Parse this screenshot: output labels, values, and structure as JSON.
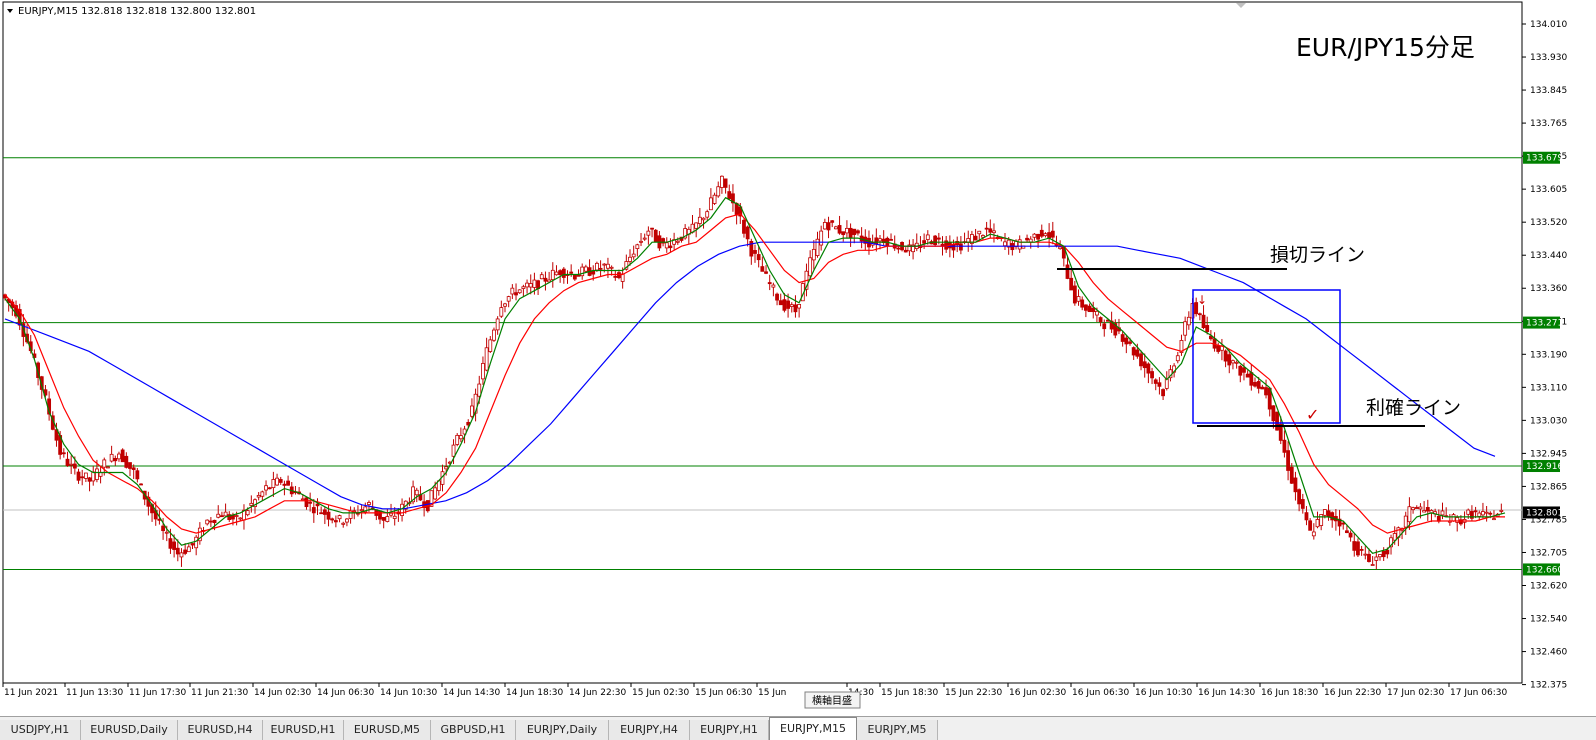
{
  "header": {
    "symbol_info": "EURJPY,M15  132.818 132.818 132.800 132.801"
  },
  "annotations": {
    "title": "EUR/JPY15分足",
    "stop_loss_label": "損切ライン",
    "take_profit_label": "利確ライン",
    "scroll_tooltip": "横軸目盛"
  },
  "colors": {
    "candle": "#c00000",
    "grid_hline": "#008000",
    "ma_fast": "#008000",
    "ma_mid": "#ff0000",
    "ma_slow": "#0000ff",
    "box": "#0000ff",
    "price_tag_bg": "#008000",
    "current_price_tag_bg": "#000000"
  },
  "chart_data": {
    "type": "candlestick",
    "symbol": "EURJPY",
    "timeframe": "M15",
    "ylim": [
      132.375,
      134.05
    ],
    "price_ticks": [
      "134.010",
      "133.930",
      "133.845",
      "133.765",
      "133.685",
      "133.605",
      "133.520",
      "133.440",
      "133.360",
      "133.271",
      "133.190",
      "133.110",
      "133.030",
      "132.945",
      "132.865",
      "132.785",
      "132.705",
      "132.620",
      "132.540",
      "132.460",
      "132.375"
    ],
    "horizontal_lines": [
      133.679,
      133.271,
      132.916,
      132.66
    ],
    "highlight_tags": [
      "133.679",
      "133.271",
      "132.916",
      "132.660"
    ],
    "current_price": "132.801",
    "time_labels": [
      "11 Jun 2021",
      "11 Jun 13:30",
      "11 Jun 17:30",
      "11 Jun 21:30",
      "14 Jun 02:30",
      "14 Jun 06:30",
      "14 Jun 10:30",
      "14 Jun 14:30",
      "14 Jun 18:30",
      "14 Jun 22:30",
      "15 Jun 02:30",
      "15 Jun 06:30",
      "15 Jun",
      "14:30",
      "15 Jun 18:30",
      "15 Jun 22:30",
      "16 Jun 02:30",
      "16 Jun 06:30",
      "16 Jun 10:30",
      "16 Jun 14:30",
      "16 Jun 18:30",
      "16 Jun 22:30",
      "17 Jun 02:30",
      "17 Jun 06:30"
    ],
    "close_path": [
      133.34,
      133.3,
      133.2,
      133.08,
      132.95,
      132.9,
      132.88,
      132.92,
      132.95,
      132.9,
      132.82,
      132.75,
      132.7,
      132.72,
      132.78,
      132.8,
      132.78,
      132.82,
      132.86,
      132.88,
      132.85,
      132.82,
      132.8,
      132.78,
      132.8,
      132.82,
      132.78,
      132.8,
      132.85,
      132.82,
      132.9,
      132.98,
      133.05,
      133.2,
      133.32,
      133.35,
      133.36,
      133.38,
      133.4,
      133.39,
      133.4,
      133.41,
      133.38,
      133.45,
      133.5,
      133.46,
      133.48,
      133.5,
      133.55,
      133.62,
      133.55,
      133.45,
      133.38,
      133.32,
      133.3,
      133.42,
      133.52,
      133.5,
      133.49,
      133.47,
      133.48,
      133.46,
      133.45,
      133.48,
      133.47,
      133.46,
      133.48,
      133.5,
      133.47,
      133.46,
      133.48,
      133.5,
      133.45,
      133.33,
      133.3,
      133.27,
      133.25,
      133.2,
      133.15,
      133.1,
      133.2,
      133.32,
      133.24,
      133.2,
      133.16,
      133.13,
      133.1,
      132.98,
      132.85,
      132.75,
      132.8,
      132.78,
      132.72,
      132.68,
      132.7,
      132.75,
      132.82,
      132.8,
      132.79,
      132.78,
      132.8,
      132.79,
      132.8
    ],
    "ma_fast": {
      "name": "",
      "values": [
        133.33,
        133.28,
        133.18,
        133.05,
        132.97,
        132.92,
        132.9,
        132.9,
        132.9,
        132.87,
        132.82,
        132.76,
        132.72,
        132.73,
        132.76,
        132.79,
        132.8,
        132.82,
        132.84,
        132.86,
        132.85,
        132.83,
        132.81,
        132.8,
        132.8,
        132.81,
        132.8,
        132.81,
        132.84,
        132.86,
        132.9,
        132.97,
        133.05,
        133.17,
        133.28,
        133.33,
        133.35,
        133.37,
        133.39,
        133.39,
        133.4,
        133.4,
        133.4,
        133.43,
        133.47,
        133.47,
        133.48,
        133.5,
        133.53,
        133.58,
        133.56,
        133.48,
        133.4,
        133.34,
        133.32,
        133.4,
        133.47,
        133.48,
        133.48,
        133.47,
        133.47,
        133.46,
        133.46,
        133.47,
        133.47,
        133.47,
        133.47,
        133.49,
        133.48,
        133.47,
        133.47,
        133.48,
        133.46,
        133.36,
        133.31,
        133.28,
        133.25,
        133.21,
        133.17,
        133.13,
        133.17,
        133.26,
        133.24,
        133.21,
        133.17,
        133.14,
        133.11,
        133.01,
        132.9,
        132.79,
        132.79,
        132.78,
        132.74,
        132.7,
        132.71,
        132.75,
        132.79,
        132.8,
        132.79,
        132.79,
        132.79,
        132.79,
        132.8
      ]
    },
    "ma_mid": {
      "name": "",
      "values": [
        133.34,
        133.3,
        133.24,
        133.15,
        133.06,
        132.99,
        132.93,
        132.9,
        132.88,
        132.86,
        132.83,
        132.79,
        132.76,
        132.75,
        132.76,
        132.77,
        132.78,
        132.79,
        132.81,
        132.83,
        132.83,
        132.83,
        132.82,
        132.81,
        132.8,
        132.8,
        132.8,
        132.8,
        132.81,
        132.82,
        132.85,
        132.9,
        132.96,
        133.05,
        133.14,
        133.22,
        133.28,
        133.32,
        133.35,
        133.37,
        133.38,
        133.39,
        133.39,
        133.41,
        133.43,
        133.44,
        133.46,
        133.47,
        133.5,
        133.53,
        133.54,
        133.5,
        133.45,
        133.4,
        133.37,
        133.38,
        133.42,
        133.44,
        133.45,
        133.45,
        133.46,
        133.46,
        133.46,
        133.46,
        133.46,
        133.47,
        133.47,
        133.48,
        133.48,
        133.47,
        133.47,
        133.47,
        133.46,
        133.42,
        133.37,
        133.33,
        133.3,
        133.27,
        133.24,
        133.21,
        133.2,
        133.22,
        133.22,
        133.21,
        133.19,
        133.16,
        133.13,
        133.07,
        133.0,
        132.92,
        132.87,
        132.84,
        132.81,
        132.77,
        132.75,
        132.76,
        132.77,
        132.78,
        132.78,
        132.78,
        132.78,
        132.79,
        132.79
      ]
    },
    "ma_slow": {
      "name": "",
      "values": [
        133.28,
        133.26,
        133.24,
        133.22,
        133.2,
        133.17,
        133.14,
        133.11,
        133.08,
        133.05,
        133.02,
        132.99,
        132.96,
        132.93,
        132.9,
        132.87,
        132.84,
        132.82,
        132.81,
        132.81,
        132.82,
        132.83,
        132.85,
        132.88,
        132.92,
        132.97,
        133.02,
        133.08,
        133.14,
        133.2,
        133.26,
        133.32,
        133.37,
        133.41,
        133.44,
        133.46,
        133.47,
        133.47,
        133.47,
        133.47,
        133.47,
        133.47,
        133.46,
        133.46,
        133.46,
        133.46,
        133.46,
        133.46,
        133.46,
        133.46,
        133.46,
        133.46,
        133.46,
        133.46,
        133.45,
        133.44,
        133.43,
        133.41,
        133.39,
        133.37,
        133.34,
        133.31,
        133.28,
        133.24,
        133.2,
        133.16,
        133.12,
        133.08,
        133.04,
        133.0,
        132.96,
        132.94
      ]
    }
  },
  "tabs": [
    {
      "label": "USDJPY,H1",
      "active": false
    },
    {
      "label": "EURUSD,Daily",
      "active": false
    },
    {
      "label": "EURUSD,H4",
      "active": false
    },
    {
      "label": "EURUSD,H1",
      "active": false
    },
    {
      "label": "EURUSD,M5",
      "active": false
    },
    {
      "label": "GBPUSD,H1",
      "active": false
    },
    {
      "label": "EURJPY,Daily",
      "active": false
    },
    {
      "label": "EURJPY,H4",
      "active": false
    },
    {
      "label": "EURJPY,H1",
      "active": false
    },
    {
      "label": "EURJPY,M15",
      "active": true
    },
    {
      "label": "EURJPY,M5",
      "active": false
    }
  ]
}
